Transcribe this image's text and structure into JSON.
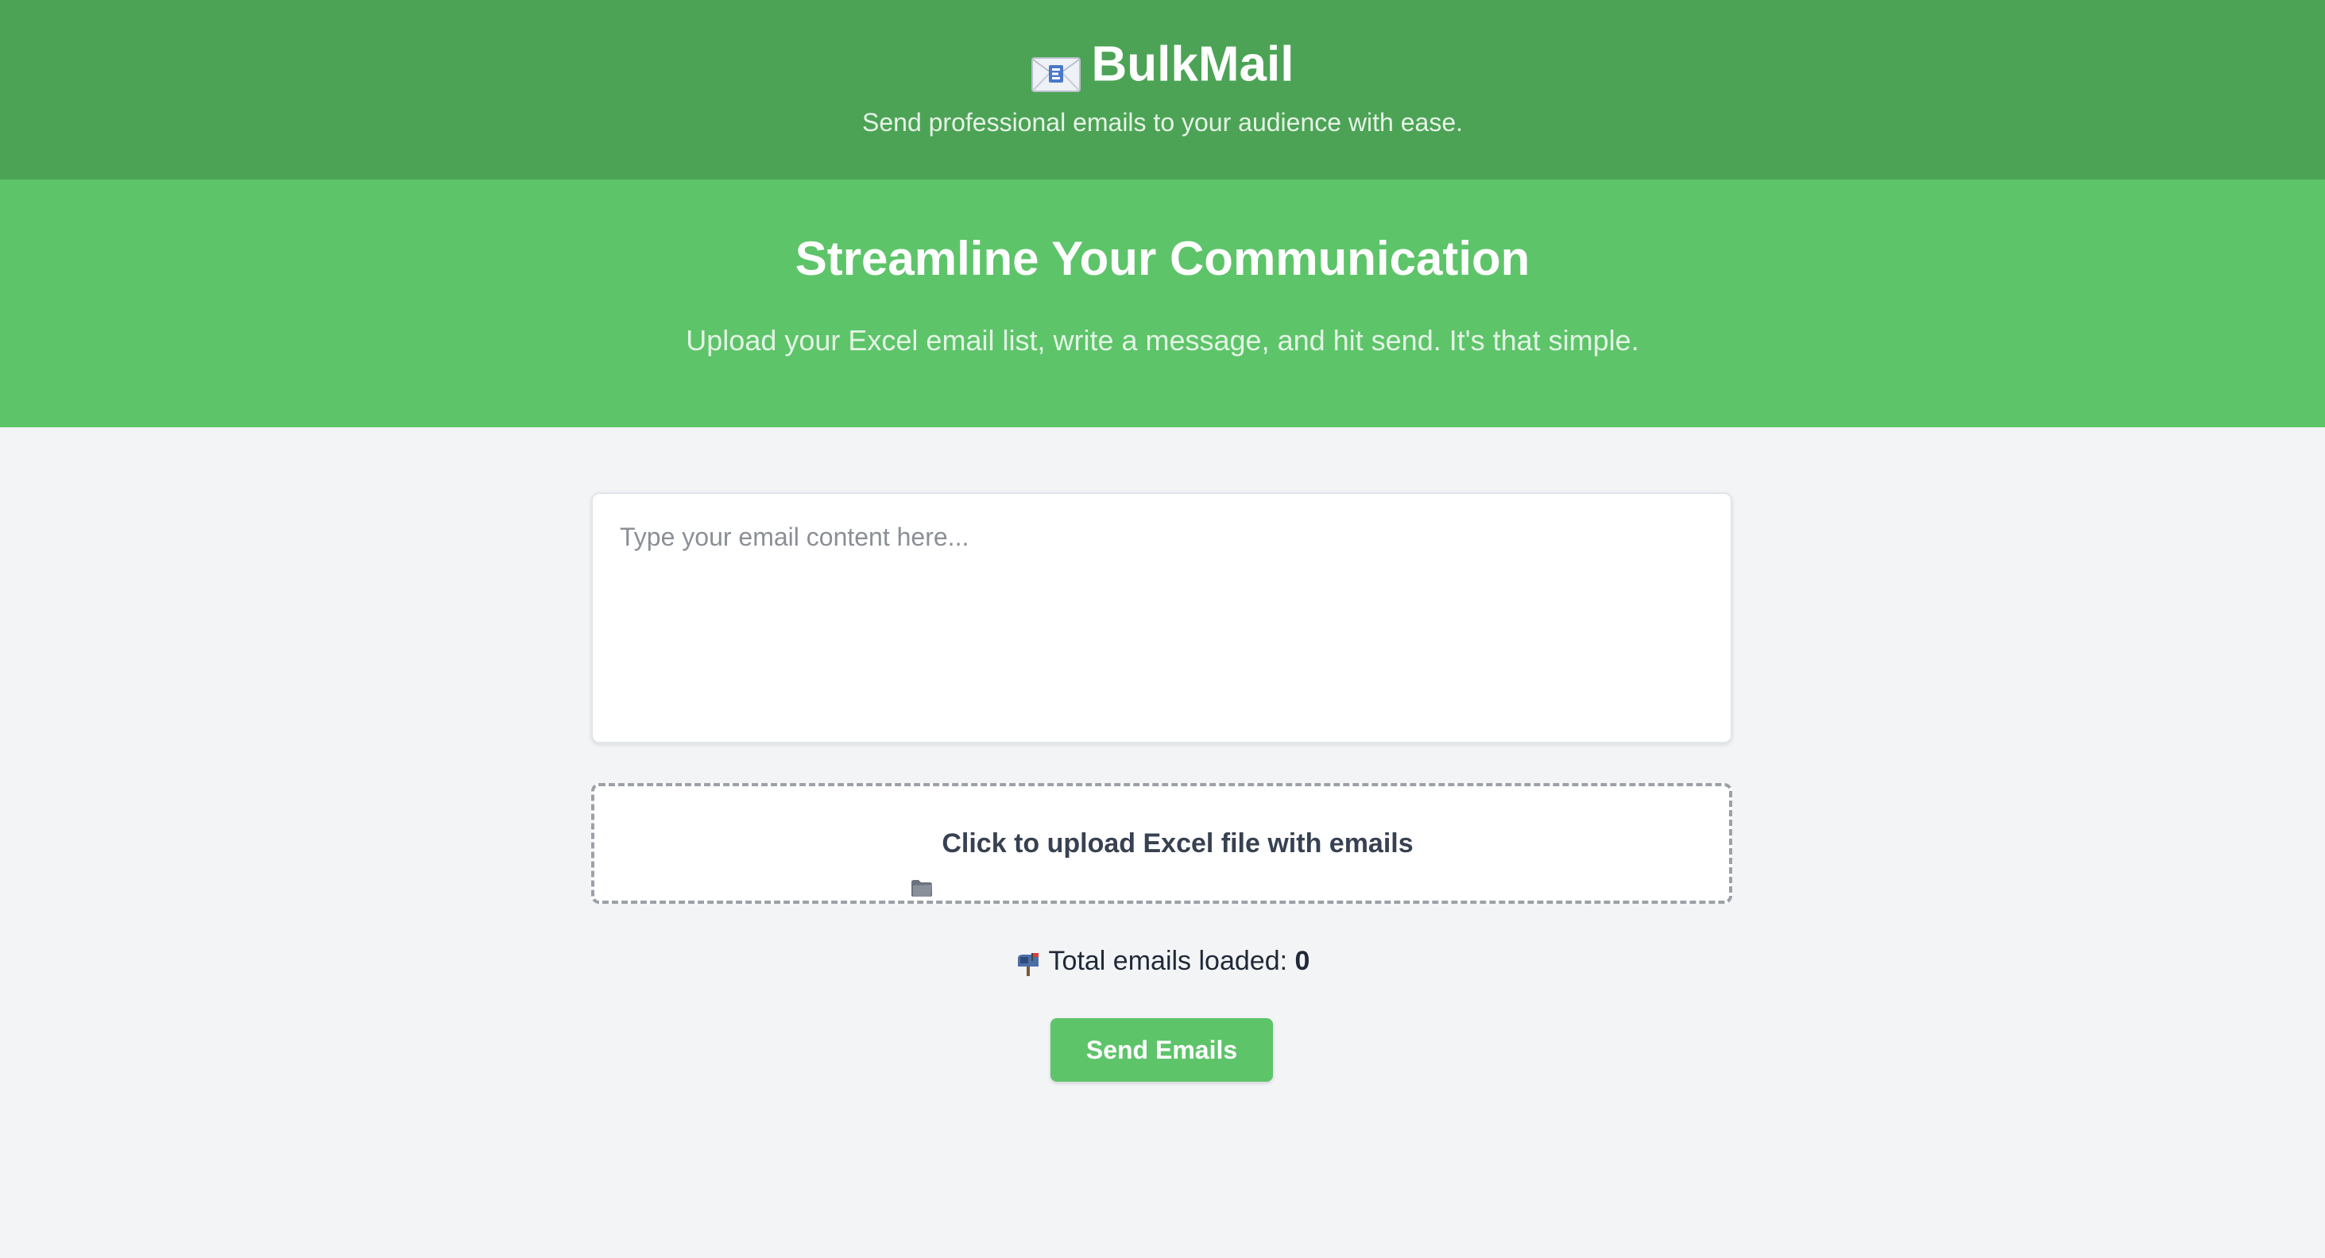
{
  "header": {
    "brand_icon": "envelope-icon",
    "title": "BulkMail",
    "tagline": "Send professional emails to your audience with ease.",
    "background": "#4ca355"
  },
  "hero": {
    "title": "Streamline Your Communication",
    "subtitle": "Upload your Excel email list, write a message, and hit send. It's that simple.",
    "background": "#5ec46a"
  },
  "composer": {
    "value": "",
    "placeholder": "Type your email content here..."
  },
  "upload": {
    "icon": "folder-icon",
    "label": "Click to upload Excel file with emails"
  },
  "status": {
    "icon": "mailbox-icon",
    "label": "Total emails loaded:",
    "count": "0"
  },
  "actions": {
    "send_label": "Send Emails",
    "accent": "#5ec46a"
  }
}
